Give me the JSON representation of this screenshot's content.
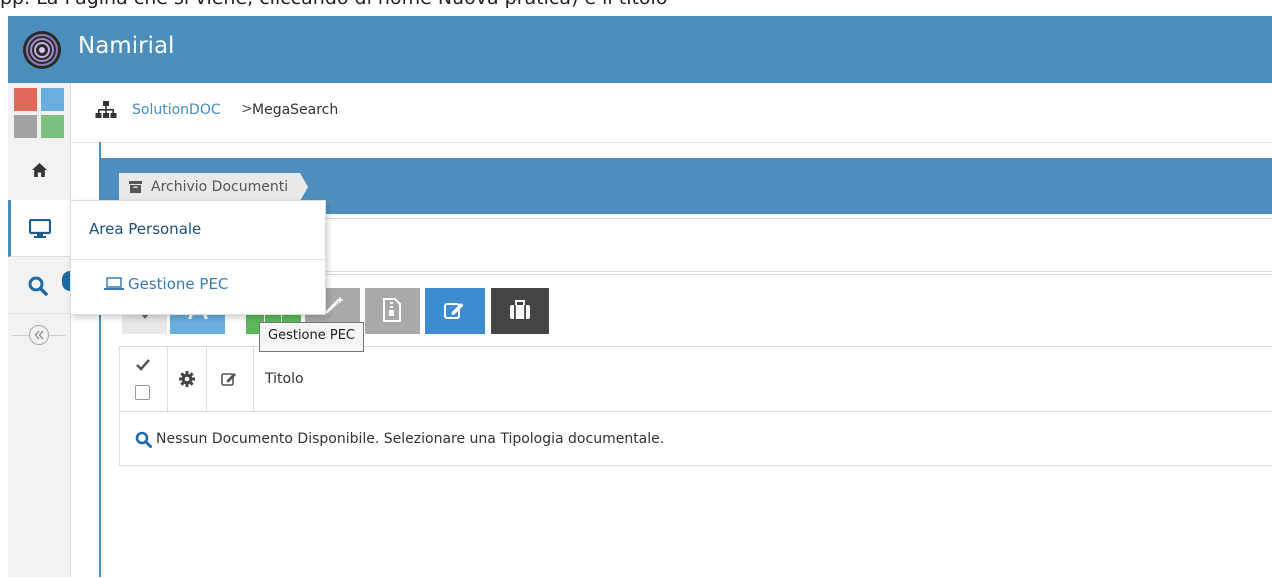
{
  "top_caption": "pp. La Pagina che si viene, cliccando di nome Nuova pratica) e il titolo",
  "header": {
    "brand": "Namirial"
  },
  "breadcrumb": {
    "link": "SolutionDOC",
    "separator": ">",
    "current": "MegaSearch"
  },
  "panel": {
    "tab_label": "Archivio Documenti"
  },
  "flyout": {
    "title": "Area Personale",
    "item": "Gestione PEC"
  },
  "tooltip": "Gestione PEC",
  "table": {
    "header_title": "Titolo",
    "empty_message": "Nessun Documento Disponibile. Selezionare una Tipologia documentale."
  },
  "colors": {
    "header": "#4a8fbc",
    "link": "#428bca",
    "blue_button": "#3c8dd0",
    "dark_button": "#444444"
  },
  "icons": [
    "logo-icon",
    "home-icon",
    "monitor-icon",
    "search-icon",
    "collapse-icon",
    "sitemap-icon",
    "archive-icon",
    "laptop-icon",
    "refresh-icon",
    "excel-icon",
    "wand-icon",
    "zip-icon",
    "edit-icon",
    "briefcase-icon",
    "check-icon",
    "gear-icon"
  ]
}
